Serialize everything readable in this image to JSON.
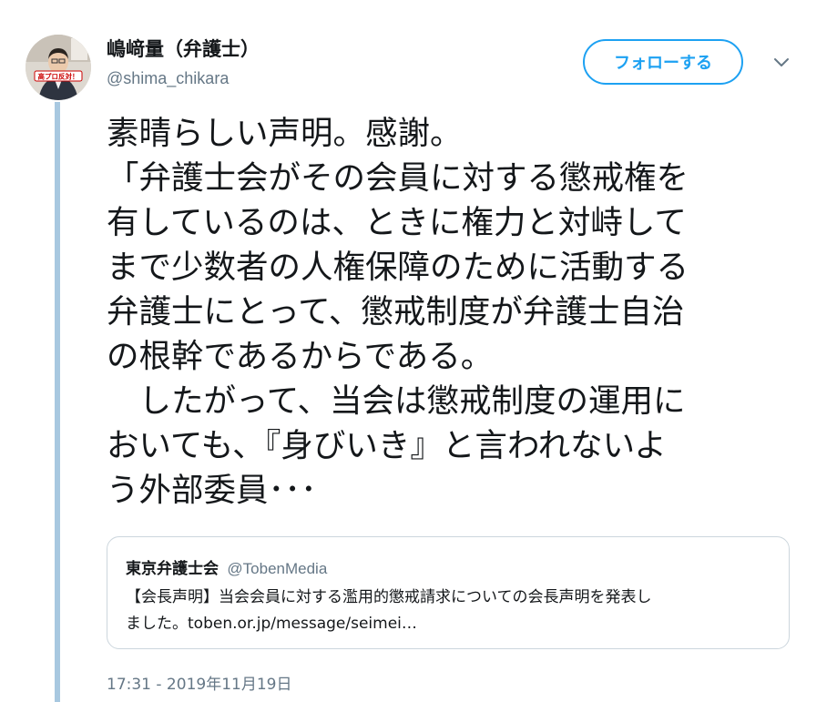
{
  "author": {
    "display_name": "嶋﨑量（弁護士）",
    "handle": "@shima_chikara",
    "avatar_sign_text": "高プロ反対！"
  },
  "follow_button_label": "フォローする",
  "tweet": {
    "lines": [
      "素晴らしい声明。感謝。",
      "「弁護士会がその会員に対する懲戒権を",
      "有しているのは、ときに権力と対峙して",
      "まで少数者の人権保障のために活動する",
      "弁護士にとって、懲戒制度が弁護士自治",
      "の根幹であるからである。",
      "　したがって、当会は懲戒制度の運用に",
      "おいても、『身びいき』と言われないよ",
      "う外部委員･･･"
    ],
    "timestamp": "17:31 - 2019年11月19日"
  },
  "quoted_tweet": {
    "name": "東京弁護士会",
    "handle": "@TobenMedia",
    "lines": [
      "【会長声明】当会会員に対する濫用的懲戒請求についての会長声明を発表し",
      "ました。toben.or.jp/message/seimei…"
    ]
  },
  "icons": {
    "more_menu": "chevron-down-icon"
  },
  "colors": {
    "accent": "#1da1f2",
    "thread_line": "#a8c8e0",
    "secondary_text": "#657786",
    "border": "#ccd6dd"
  }
}
